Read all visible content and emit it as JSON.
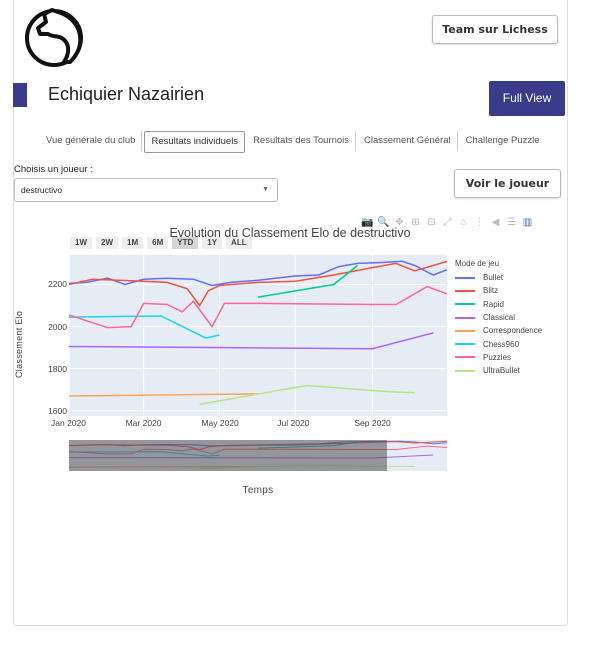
{
  "header": {
    "logo_icon": "lichess-knight-icon",
    "team_button_label": "Team sur Lichess",
    "title": "Echiquier Nazairien",
    "full_view_label": "Full View",
    "brand_color": "#3b3b8c"
  },
  "tabs": [
    {
      "label": "Vue générale du club",
      "active": false
    },
    {
      "label": "Resultats individuels",
      "active": true
    },
    {
      "label": "Resultats des Tournois",
      "active": false
    },
    {
      "label": "Classement Général",
      "active": false
    },
    {
      "label": "Challenge Puzzle",
      "active": false
    }
  ],
  "player_select": {
    "label": "Choisis un joueur :",
    "value": "destructivo"
  },
  "voir_button_label": "Voir le joueur",
  "modebar_icons": [
    "camera-icon",
    "zoom-icon",
    "pan-icon",
    "zoom-in-icon",
    "zoom-out-icon",
    "autoscale-icon",
    "reset-axes-icon",
    "spike-lines-icon",
    "hover-closest-icon",
    "hover-compare-icon",
    "plotly-logo-icon"
  ],
  "chart_data": {
    "type": "line",
    "title": "Evolution du Classement Elo de destructivo",
    "xlabel": "Temps",
    "ylabel": "Classement Elo",
    "range_buttons": [
      "1W",
      "2W",
      "1M",
      "6M",
      "YTD",
      "1Y",
      "ALL"
    ],
    "active_range": "YTD",
    "x_ticks": [
      "Jan 2020",
      "Mar 2020",
      "May 2020",
      "Jul 2020",
      "Sep 2020"
    ],
    "y_ticks": [
      1600,
      1800,
      2000,
      2200
    ],
    "ylim": [
      1575,
      2340
    ],
    "xlim": [
      "2020-01-01",
      "2020-10-31"
    ],
    "legend_title": "Mode de jeu",
    "legend_position": "right",
    "series": [
      {
        "name": "Bullet",
        "color": "#636efa",
        "points": [
          [
            "2020-01-01",
            2205
          ],
          [
            "2020-01-15",
            2210
          ],
          [
            "2020-02-01",
            2230
          ],
          [
            "2020-02-15",
            2200
          ],
          [
            "2020-03-01",
            2225
          ],
          [
            "2020-03-20",
            2230
          ],
          [
            "2020-04-10",
            2225
          ],
          [
            "2020-04-25",
            2195
          ],
          [
            "2020-05-10",
            2210
          ],
          [
            "2020-06-01",
            2220
          ],
          [
            "2020-07-01",
            2240
          ],
          [
            "2020-07-20",
            2245
          ],
          [
            "2020-08-05",
            2285
          ],
          [
            "2020-08-20",
            2300
          ],
          [
            "2020-09-10",
            2305
          ],
          [
            "2020-09-25",
            2310
          ],
          [
            "2020-10-05",
            2290
          ],
          [
            "2020-10-20",
            2245
          ],
          [
            "2020-10-31",
            2270
          ]
        ]
      },
      {
        "name": "Blitz",
        "color": "#ef553b",
        "points": [
          [
            "2020-01-01",
            2200
          ],
          [
            "2020-01-20",
            2225
          ],
          [
            "2020-02-10",
            2220
          ],
          [
            "2020-03-01",
            2215
          ],
          [
            "2020-03-20",
            2210
          ],
          [
            "2020-04-05",
            2180
          ],
          [
            "2020-04-15",
            2100
          ],
          [
            "2020-04-22",
            2170
          ],
          [
            "2020-05-01",
            2195
          ],
          [
            "2020-06-01",
            2210
          ],
          [
            "2020-07-01",
            2215
          ],
          [
            "2020-08-01",
            2245
          ],
          [
            "2020-09-01",
            2280
          ],
          [
            "2020-09-20",
            2300
          ],
          [
            "2020-10-05",
            2265
          ],
          [
            "2020-10-20",
            2290
          ],
          [
            "2020-10-31",
            2310
          ]
        ]
      },
      {
        "name": "Rapid",
        "color": "#00cc96",
        "points": [
          [
            "2020-06-01",
            2140
          ],
          [
            "2020-08-01",
            2200
          ],
          [
            "2020-08-20",
            2290
          ]
        ]
      },
      {
        "name": "Classical",
        "color": "#ab63fa",
        "points": [
          [
            "2020-01-01",
            1905
          ],
          [
            "2020-09-01",
            1895
          ],
          [
            "2020-10-20",
            1970
          ]
        ]
      },
      {
        "name": "Correspondence",
        "color": "#ffa15a",
        "points": [
          [
            "2020-01-01",
            1670
          ],
          [
            "2020-06-01",
            1680
          ]
        ]
      },
      {
        "name": "Chess960",
        "color": "#19d3f3",
        "points": [
          [
            "2020-01-01",
            2045
          ],
          [
            "2020-03-15",
            2050
          ],
          [
            "2020-04-20",
            1945
          ],
          [
            "2020-05-01",
            1960
          ]
        ]
      },
      {
        "name": "Puzzles",
        "color": "#ff6692",
        "points": [
          [
            "2020-01-01",
            2055
          ],
          [
            "2020-02-01",
            1995
          ],
          [
            "2020-02-20",
            2000
          ],
          [
            "2020-03-01",
            2110
          ],
          [
            "2020-03-20",
            2105
          ],
          [
            "2020-04-01",
            2070
          ],
          [
            "2020-04-10",
            2120
          ],
          [
            "2020-04-25",
            2000
          ],
          [
            "2020-05-05",
            2110
          ],
          [
            "2020-06-01",
            2110
          ],
          [
            "2020-09-01",
            2105
          ],
          [
            "2020-09-20",
            2105
          ],
          [
            "2020-10-15",
            2190
          ],
          [
            "2020-10-31",
            2155
          ]
        ]
      },
      {
        "name": "UltraBullet",
        "color": "#b6e880",
        "points": [
          [
            "2020-04-15",
            1630
          ],
          [
            "2020-07-10",
            1720
          ],
          [
            "2020-09-15",
            1690
          ],
          [
            "2020-10-05",
            1685
          ]
        ]
      }
    ]
  }
}
